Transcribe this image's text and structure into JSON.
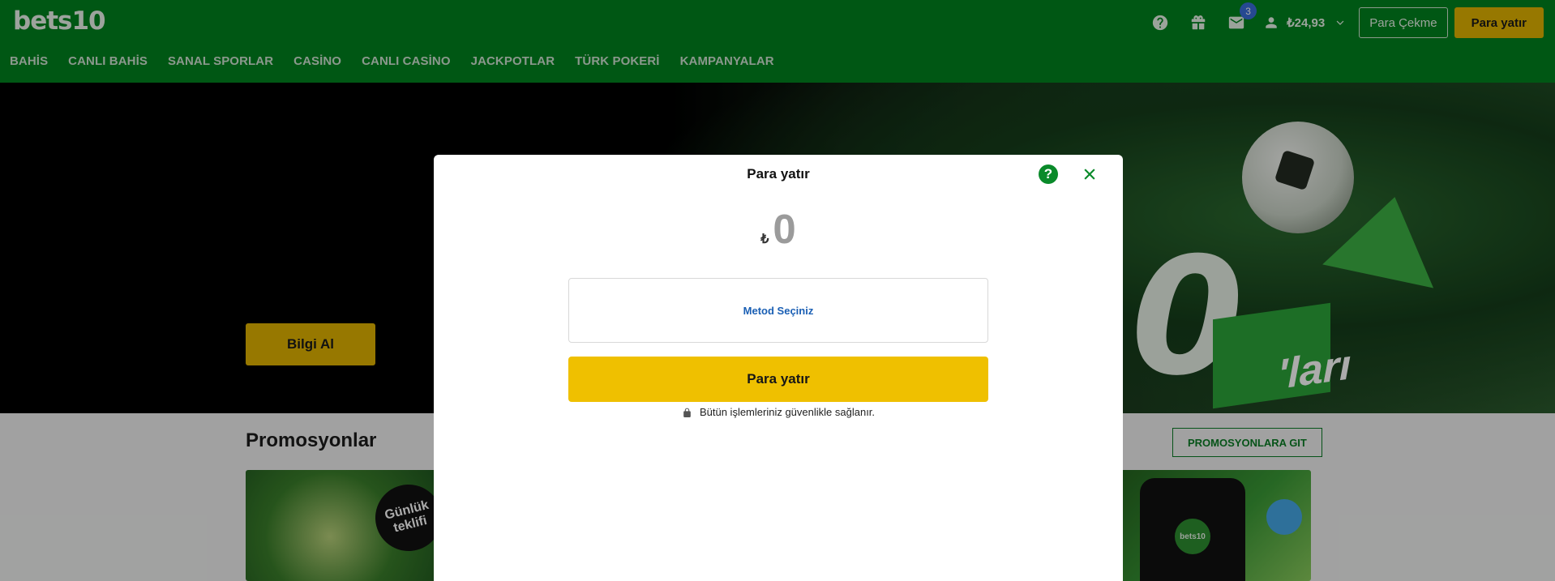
{
  "header": {
    "logo": "bets10",
    "message_count": "3",
    "balance": "₺24,93",
    "withdraw_label": "Para Çekme",
    "deposit_label": "Para yatır",
    "icons": [
      "help-icon",
      "gift-icon",
      "mail-icon",
      "user-icon",
      "chevron-down-icon"
    ]
  },
  "nav": {
    "items": [
      {
        "label": "BAHİS"
      },
      {
        "label": "CANLI BAHİS"
      },
      {
        "label": "SANAL SPORLAR"
      },
      {
        "label": "CASİNO"
      },
      {
        "label": "CANLI CASİNO"
      },
      {
        "label": "JACKPOTLAR"
      },
      {
        "label": "TÜRK POKERİ"
      },
      {
        "label": "KAMPANYALAR"
      }
    ]
  },
  "hero": {
    "info_button": "Bilgi Al",
    "big_text": "0",
    "sign_text": "'ları"
  },
  "promotions": {
    "title": "Promosyonlar",
    "goto_label": "PROMOSYONLARA GIT",
    "card1_badge": "Günlük teklifi",
    "card2_brand": "bets10"
  },
  "modal": {
    "title": "Para yatır",
    "currency": "₺",
    "amount": "0",
    "method_placeholder": "Metod Seçiniz",
    "submit_label": "Para yatır",
    "secure_note": "Bütün işlemleriniz güvenlikle sağlanır."
  },
  "colors": {
    "header_green": "#00821f",
    "accent_yellow": "#efc000",
    "modal_green": "#0a8a2a",
    "link_blue": "#1a5fb4"
  }
}
